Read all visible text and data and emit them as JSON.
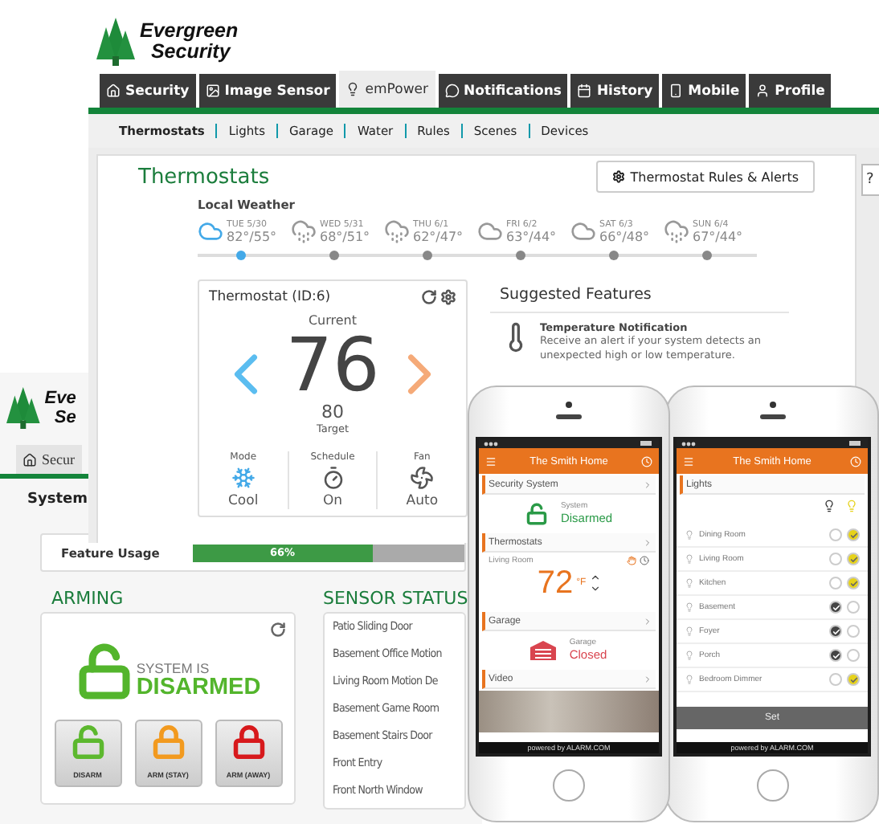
{
  "main_window": {
    "logo": [
      "Evergreen",
      "Security"
    ],
    "tabs": [
      {
        "label": "Security",
        "selected": false
      },
      {
        "label": "Image Sensor",
        "selected": false
      },
      {
        "label": "emPower",
        "selected": true
      },
      {
        "label": "Notifications",
        "selected": false
      },
      {
        "label": "History",
        "selected": false
      },
      {
        "label": "Mobile",
        "selected": false
      },
      {
        "label": "Profile",
        "selected": false
      }
    ],
    "subnav": [
      {
        "label": "Thermostats",
        "selected": true
      },
      {
        "label": "Lights",
        "selected": false
      },
      {
        "label": "Garage",
        "selected": false
      },
      {
        "label": "Water",
        "selected": false
      },
      {
        "label": "Rules",
        "selected": false
      },
      {
        "label": "Scenes",
        "selected": false
      },
      {
        "label": "Devices",
        "selected": false
      }
    ],
    "panel_title": "Thermostats",
    "rules_button": "Thermostat Rules & Alerts",
    "help_button": "?",
    "weather": {
      "label": "Local Weather",
      "days": [
        {
          "day": "TUE 5/30",
          "temps": "82°/55°",
          "kind": "cloud",
          "selected": true
        },
        {
          "day": "WED 5/31",
          "temps": "68°/51°",
          "kind": "rain",
          "selected": false
        },
        {
          "day": "THU 6/1",
          "temps": "62°/47°",
          "kind": "rain",
          "selected": false
        },
        {
          "day": "FRI 6/2",
          "temps": "63°/44°",
          "kind": "cloud",
          "selected": false
        },
        {
          "day": "SAT 6/3",
          "temps": "66°/48°",
          "kind": "cloud",
          "selected": false
        },
        {
          "day": "SUN 6/4",
          "temps": "67°/44°",
          "kind": "rain",
          "selected": false
        }
      ]
    },
    "thermostat": {
      "title": "Thermostat (ID:6)",
      "current_label": "Current",
      "current": "76",
      "target": "80",
      "target_label": "Target",
      "modes": [
        {
          "kind": "mode",
          "label": "Mode",
          "value": "Cool"
        },
        {
          "kind": "schedule",
          "label": "Schedule",
          "value": "On"
        },
        {
          "kind": "fan",
          "label": "Fan",
          "value": "Auto"
        }
      ]
    },
    "suggested": {
      "title": "Suggested Features",
      "features": [
        {
          "title": "Temperature Notification",
          "description": "Receive an alert if your system detects an unexpected high or low temperature."
        }
      ]
    }
  },
  "back_window": {
    "logo": [
      "Eve",
      "Se"
    ],
    "tab": "Secur",
    "section": "System",
    "feature_usage": {
      "label": "Feature Usage",
      "reading": "66%",
      "level": 0.66
    },
    "arming": {
      "title": "ARMING",
      "status": [
        "SYSTEM IS",
        "DISARMED"
      ],
      "buttons": [
        {
          "label": "DISARM",
          "color": "#5cb82e",
          "kind": "open"
        },
        {
          "label": "ARM (STAY)",
          "color": "#f29a1f",
          "kind": "closed"
        },
        {
          "label": "ARM (AWAY)",
          "color": "#d7191c",
          "kind": "closed"
        }
      ]
    },
    "sensor_status": {
      "title": "SENSOR STATUS",
      "sensors": [
        "Patio Sliding Door",
        "Basement Office Motion",
        "Living Room Motion De",
        "Basement Game Room",
        "Basement Stairs Door",
        "Front Entry",
        "Front North Window"
      ]
    }
  },
  "phone_dashboard": {
    "title": "The Smith Home",
    "sections": [
      {
        "kind": "security",
        "title": "Security System",
        "label": "System",
        "value": "Disarmed"
      },
      {
        "kind": "thermostat",
        "title": "Thermostats",
        "label": "Living Room",
        "value": "72",
        "unit": "°F"
      },
      {
        "kind": "garage",
        "title": "Garage",
        "label": "Garage",
        "value": "Closed"
      },
      {
        "kind": "video",
        "title": "Video"
      }
    ],
    "footer": "powered by ALARM.COM"
  },
  "phone_lights": {
    "title": "The Smith Home",
    "section": "Lights",
    "lights": [
      {
        "name": "Dining Room",
        "on": true
      },
      {
        "name": "Living Room",
        "on": true
      },
      {
        "name": "Kitchen",
        "on": true
      },
      {
        "name": "Basement",
        "on": false
      },
      {
        "name": "Foyer",
        "on": false
      },
      {
        "name": "Porch",
        "on": false
      },
      {
        "name": "Bedroom Dimmer",
        "on": true
      }
    ],
    "button": "Set",
    "footer": "powered by ALARM.COM"
  }
}
